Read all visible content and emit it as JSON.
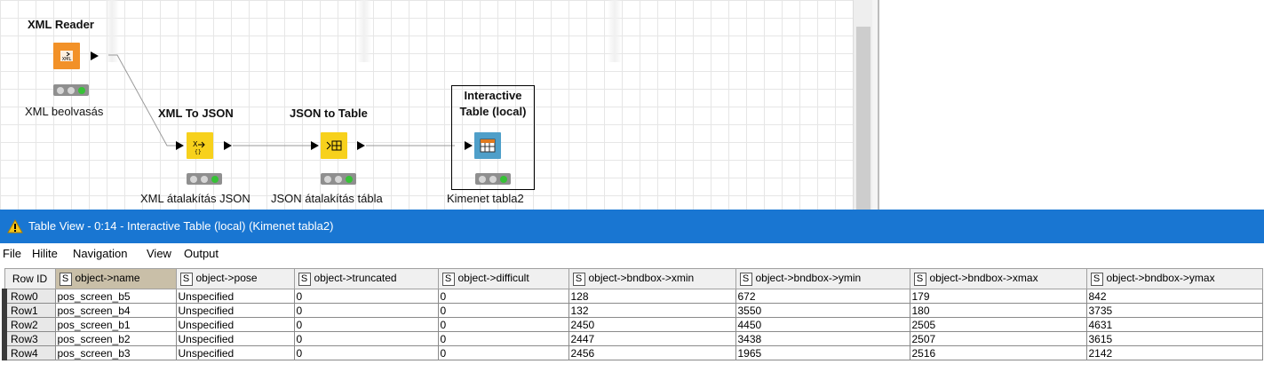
{
  "workflow": {
    "nodes": [
      {
        "title": "XML Reader",
        "label": "XML beolvasás",
        "icon": "xml-reader-icon",
        "color": "#f29128"
      },
      {
        "title": "XML To JSON",
        "label": "XML átalakítás JSON",
        "icon": "xml-to-json-icon",
        "color": "#f7d11c"
      },
      {
        "title": "JSON to Table",
        "label": "JSON átalakítás tábla",
        "icon": "json-to-table-icon",
        "color": "#f7d11c"
      },
      {
        "title": "Interactive\nTable (local)",
        "label": "Kimenet tabla2",
        "icon": "interactive-table-icon",
        "color": "#4f9fc9"
      }
    ]
  },
  "window": {
    "title": "Table View - 0:14 - Interactive Table (local) (Kimenet tabla2)",
    "title_color": "#1976d2"
  },
  "menu": [
    "File",
    "Hilite",
    "Navigation",
    "View",
    "Output"
  ],
  "table": {
    "rowid_header": "Row ID",
    "type_badge": "S",
    "columns": [
      "object->name",
      "object->pose",
      "object->truncated",
      "object->difficult",
      "object->bndbox->xmin",
      "object->bndbox->ymin",
      "object->bndbox->xmax",
      "object->bndbox->ymax"
    ],
    "rows": [
      {
        "id": "Row0",
        "cells": [
          "pos_screen_b5",
          "Unspecified",
          "0",
          "0",
          "128",
          "672",
          "179",
          "842"
        ]
      },
      {
        "id": "Row1",
        "cells": [
          "pos_screen_b4",
          "Unspecified",
          "0",
          "0",
          "132",
          "3550",
          "180",
          "3735"
        ]
      },
      {
        "id": "Row2",
        "cells": [
          "pos_screen_b1",
          "Unspecified",
          "0",
          "0",
          "2450",
          "4450",
          "2505",
          "4631"
        ]
      },
      {
        "id": "Row3",
        "cells": [
          "pos_screen_b2",
          "Unspecified",
          "0",
          "0",
          "2447",
          "3438",
          "2507",
          "3615"
        ]
      },
      {
        "id": "Row4",
        "cells": [
          "pos_screen_b3",
          "Unspecified",
          "0",
          "0",
          "2456",
          "1965",
          "2516",
          "2142"
        ]
      }
    ]
  }
}
